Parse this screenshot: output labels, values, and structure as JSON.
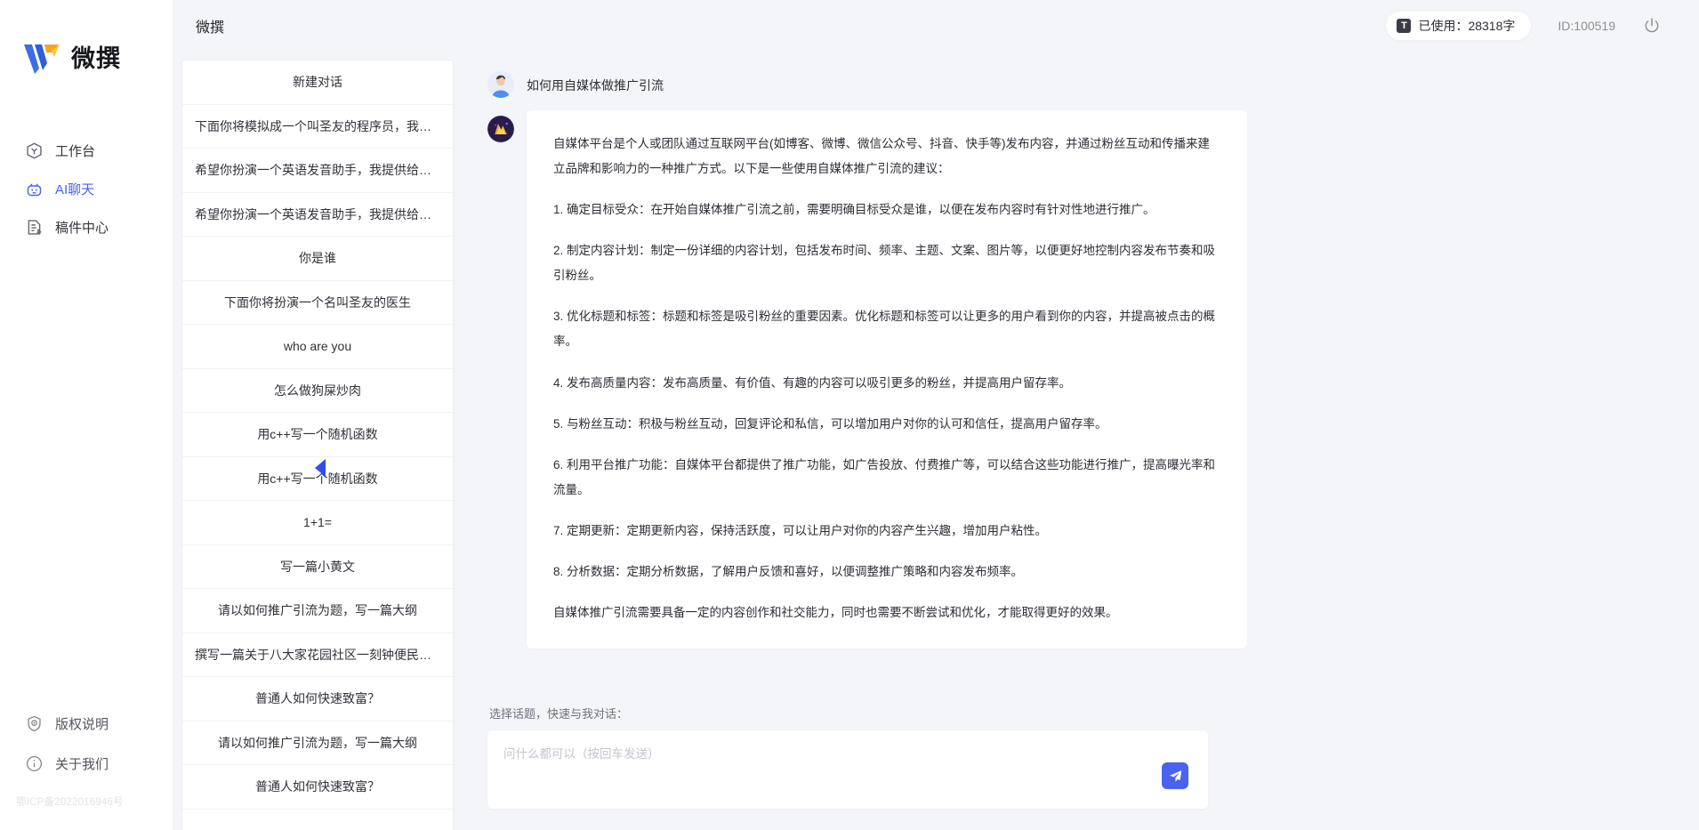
{
  "brand": {
    "name": "微撰",
    "logo_icon": "w-logo-icon"
  },
  "sidebar": {
    "items": [
      {
        "label": "工作台",
        "icon": "workbench-hexagon-icon",
        "active": false
      },
      {
        "label": "AI聊天",
        "icon": "ai-robot-icon",
        "active": true
      },
      {
        "label": "稿件中心",
        "icon": "document-edit-icon",
        "active": false
      }
    ],
    "bottom_items": [
      {
        "label": "版权说明",
        "icon": "shield-copyright-icon"
      },
      {
        "label": "关于我们",
        "icon": "info-circle-icon"
      }
    ],
    "icp": "鄂ICP备2022016946号"
  },
  "topbar": {
    "title": "微撰",
    "usage_badge_letter": "T",
    "usage_label": "已使用：28318字",
    "user_id": "ID:100519",
    "power_icon": "power-icon"
  },
  "conversations": {
    "new_chat_label": "新建对话",
    "items": [
      "下面你将模拟成一个叫圣友的程序员，我说...",
      "希望你扮演一个英语发音助手，我提供给你...",
      "希望你扮演一个英语发音助手，我提供给你...",
      "你是谁",
      "下面你将扮演一个名叫圣友的医生",
      "who are you",
      "怎么做狗屎炒肉",
      "用c++写一个随机函数",
      "用c++写一个随机函数",
      "1+1=",
      "写一篇小黄文",
      "请以如何推广引流为题，写一篇大纲",
      "撰写一篇关于八大家花园社区一刻钟便民生...",
      "普通人如何快速致富？",
      "请以如何推广引流为题，写一篇大纲",
      "普通人如何快速致富？"
    ]
  },
  "collapse_handle": {
    "icon": "chevron-left-triangle-icon"
  },
  "chat": {
    "user_message": {
      "avatar_icon": "user-avatar-icon",
      "text": "如何用自媒体做推广引流"
    },
    "ai_message": {
      "avatar_icon": "ai-avatar-icon",
      "paragraphs": [
        "自媒体平台是个人或团队通过互联网平台(如博客、微博、微信公众号、抖音、快手等)发布内容，并通过粉丝互动和传播来建立品牌和影响力的一种推广方式。以下是一些使用自媒体推广引流的建议：",
        "1. 确定目标受众：在开始自媒体推广引流之前，需要明确目标受众是谁，以便在发布内容时有针对性地进行推广。",
        "2. 制定内容计划：制定一份详细的内容计划，包括发布时间、频率、主题、文案、图片等，以便更好地控制内容发布节奏和吸引粉丝。",
        "3. 优化标题和标签：标题和标签是吸引粉丝的重要因素。优化标题和标签可以让更多的用户看到你的内容，并提高被点击的概率。",
        "4. 发布高质量内容：发布高质量、有价值、有趣的内容可以吸引更多的粉丝，并提高用户留存率。",
        "5. 与粉丝互动：积极与粉丝互动，回复评论和私信，可以增加用户对你的认可和信任，提高用户留存率。",
        "6. 利用平台推广功能：自媒体平台都提供了推广功能，如广告投放、付费推广等，可以结合这些功能进行推广，提高曝光率和流量。",
        "7. 定期更新：定期更新内容，保持活跃度，可以让用户对你的内容产生兴趣，增加用户粘性。",
        "8. 分析数据：定期分析数据，了解用户反馈和喜好，以便调整推广策略和内容发布频率。",
        "自媒体推广引流需要具备一定的内容创作和社交能力，同时也需要不断尝试和优化，才能取得更好的效果。"
      ]
    }
  },
  "composer": {
    "label": "选择话题，快速与我对话：",
    "placeholder": "问什么都可以（按回车发送）",
    "send_icon": "send-paper-plane-icon"
  },
  "colors": {
    "accent": "#4b62f0",
    "page_bg": "#f4f5f9",
    "panel_bg": "#ffffff",
    "text": "#2c2e35",
    "muted": "#8c8f99"
  }
}
